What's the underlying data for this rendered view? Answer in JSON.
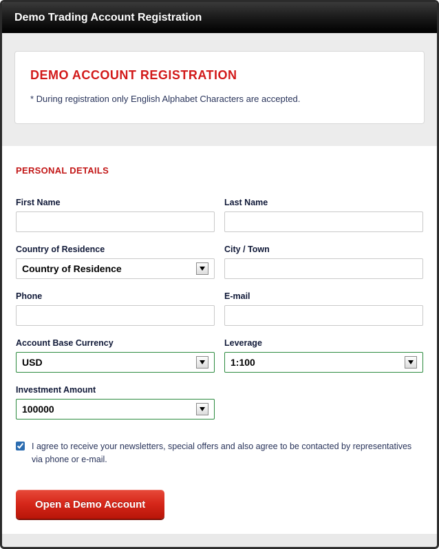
{
  "titlebar": "Demo Trading Account Registration",
  "intro": {
    "heading": "DEMO ACCOUNT REGISTRATION",
    "note": "* During registration only English Alphabet Characters are accepted."
  },
  "section_heading": "PERSONAL DETAILS",
  "fields": {
    "first_name": {
      "label": "First Name",
      "value": ""
    },
    "last_name": {
      "label": "Last Name",
      "value": ""
    },
    "country": {
      "label": "Country of Residence",
      "value": "Country of Residence"
    },
    "city": {
      "label": "City / Town",
      "value": ""
    },
    "phone": {
      "label": "Phone",
      "value": ""
    },
    "email": {
      "label": "E-mail",
      "value": ""
    },
    "currency": {
      "label": "Account Base Currency",
      "value": "USD"
    },
    "leverage": {
      "label": "Leverage",
      "value": "1:100"
    },
    "investment": {
      "label": "Investment Amount",
      "value": "100000"
    }
  },
  "consent": {
    "checked": true,
    "text": "I agree to receive your newsletters, special offers and also agree to be contacted by representatives via phone or e-mail."
  },
  "submit_label": "Open a Demo Account"
}
